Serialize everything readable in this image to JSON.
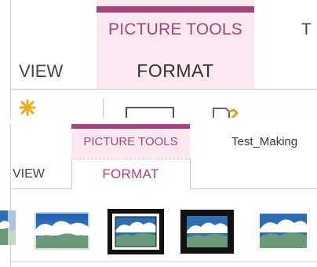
{
  "top": {
    "contextual_group": "PICTURE TOOLS",
    "clipped_tab": "T",
    "tabs": {
      "view": "VIEW",
      "format": "FORMAT"
    }
  },
  "bottom": {
    "contextual_group": "PICTURE TOOLS",
    "document_title": "Test_Making",
    "tabs": {
      "view": "VIEW",
      "format": "FORMAT"
    },
    "picture_styles_gallery": [
      {
        "name": "partial-style"
      },
      {
        "name": "soft-edge-rectangle"
      },
      {
        "name": "thick-black-frame-with-white-mat"
      },
      {
        "name": "thick-black-frame"
      },
      {
        "name": "simple-white-border"
      }
    ]
  },
  "colors": {
    "accent": "#a5457c",
    "contextual_bg": "#fbe9f2",
    "sky": "#2e6db4",
    "hills": "#6a9a7a",
    "frame": "#111111"
  }
}
